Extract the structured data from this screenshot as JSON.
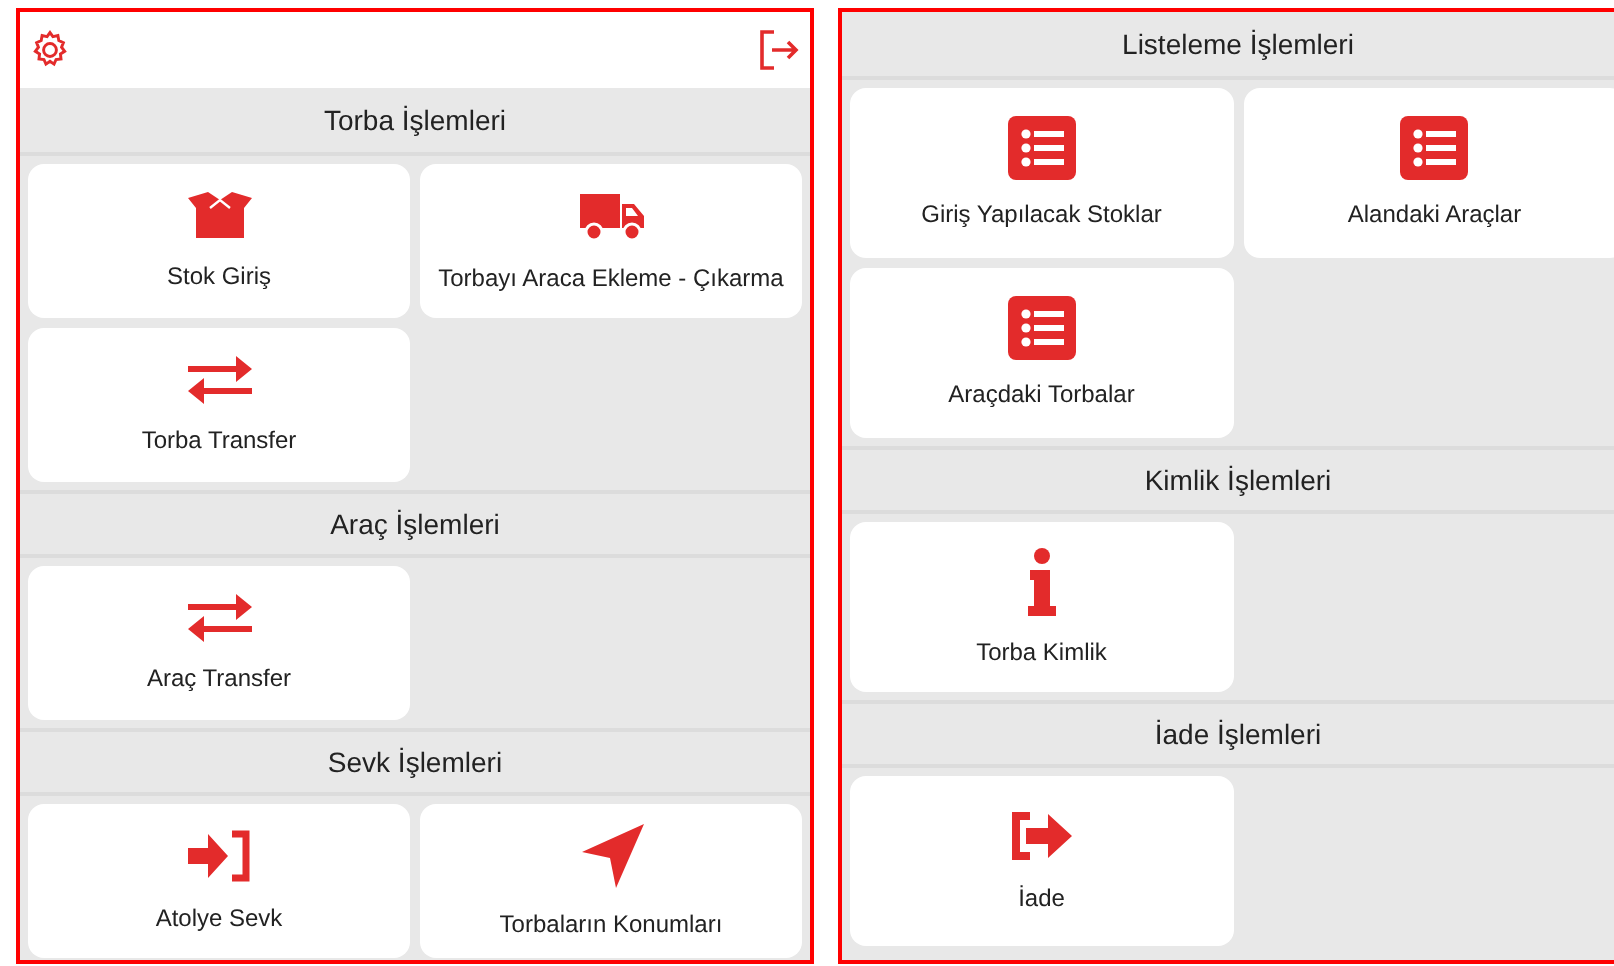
{
  "left_panel": {
    "sections": [
      {
        "title": "Torba İşlemleri",
        "items": [
          {
            "label": "Stok Giriş",
            "kind": "box"
          },
          {
            "label": "Torbayı Araca Ekleme - Çıkarma",
            "kind": "truck"
          },
          {
            "label": "Torba Transfer",
            "kind": "swap"
          }
        ]
      },
      {
        "title": "Araç İşlemleri",
        "items": [
          {
            "label": "Araç Transfer",
            "kind": "swap"
          }
        ]
      },
      {
        "title": "Sevk İşlemleri",
        "items": [
          {
            "label": "Atolye Sevk",
            "kind": "enter"
          },
          {
            "label": "Torbaların Konumları",
            "kind": "location"
          }
        ]
      }
    ]
  },
  "right_panel": {
    "sections": [
      {
        "title": "Listeleme İşlemleri",
        "items": [
          {
            "label": "Giriş Yapılacak Stoklar",
            "kind": "list"
          },
          {
            "label": "Alandaki Araçlar",
            "kind": "list"
          },
          {
            "label": "Araçdaki Torbalar",
            "kind": "list"
          }
        ]
      },
      {
        "title": "Kimlik İşlemleri",
        "items": [
          {
            "label": "Torba Kimlik",
            "kind": "info"
          }
        ]
      },
      {
        "title": "İade İşlemleri",
        "items": [
          {
            "label": "İade",
            "kind": "exit"
          }
        ]
      }
    ]
  }
}
